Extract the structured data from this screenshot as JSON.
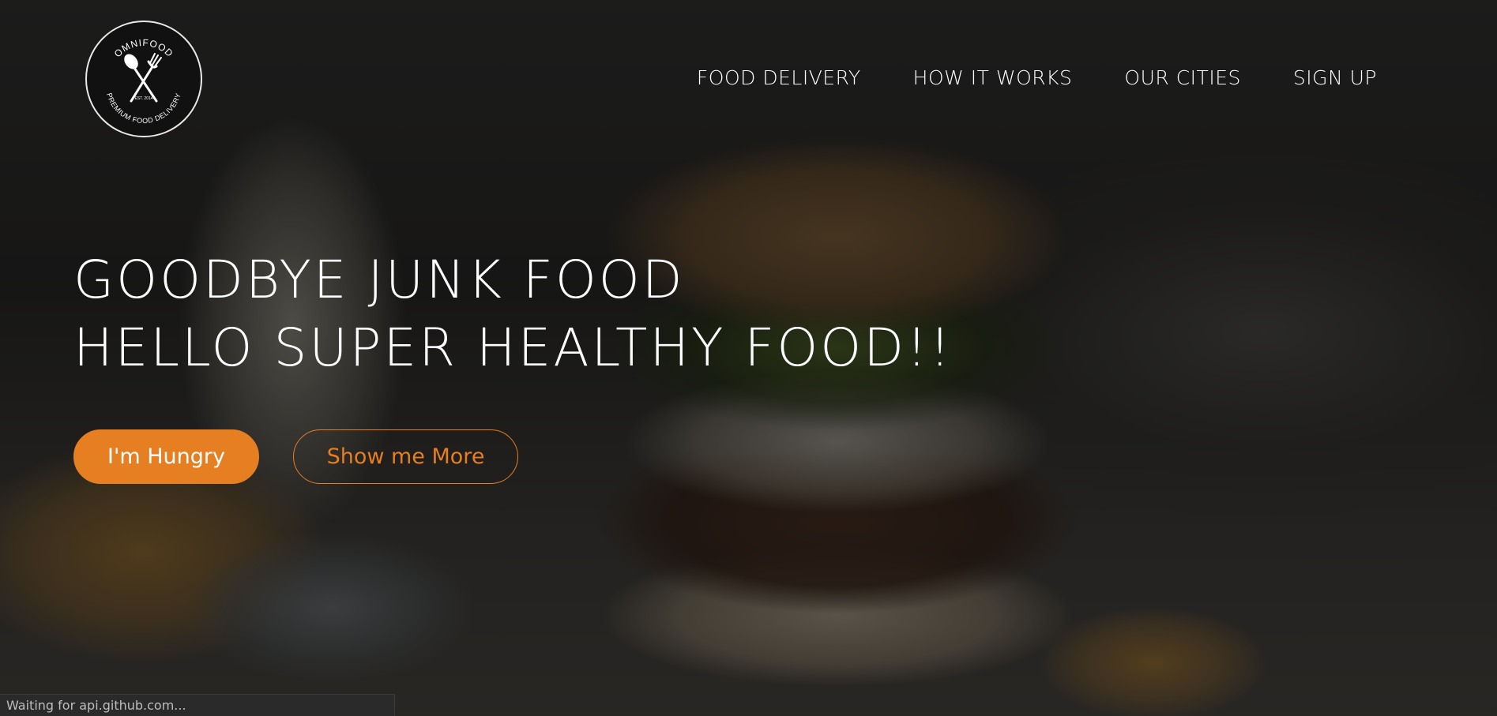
{
  "logo": {
    "brand": "OMNIFOOD",
    "tagline": "PREMIUM FOOD DELIVERY",
    "est": "EST. 2014"
  },
  "nav": {
    "items": [
      {
        "label": "FOOD DELIVERY"
      },
      {
        "label": "HOW IT WORKS"
      },
      {
        "label": "OUR CITIES"
      },
      {
        "label": "SIGN UP"
      }
    ]
  },
  "hero": {
    "headline_line1": "GOODBYE JUNK FOOD",
    "headline_line2": "HELLO SUPER HEALTHY FOOD!!",
    "primary_button": "I'm Hungry",
    "secondary_button": "Show me More"
  },
  "status_bar": {
    "text": "Waiting for api.github.com..."
  },
  "colors": {
    "accent": "#e67e22",
    "text": "#ffffff"
  }
}
